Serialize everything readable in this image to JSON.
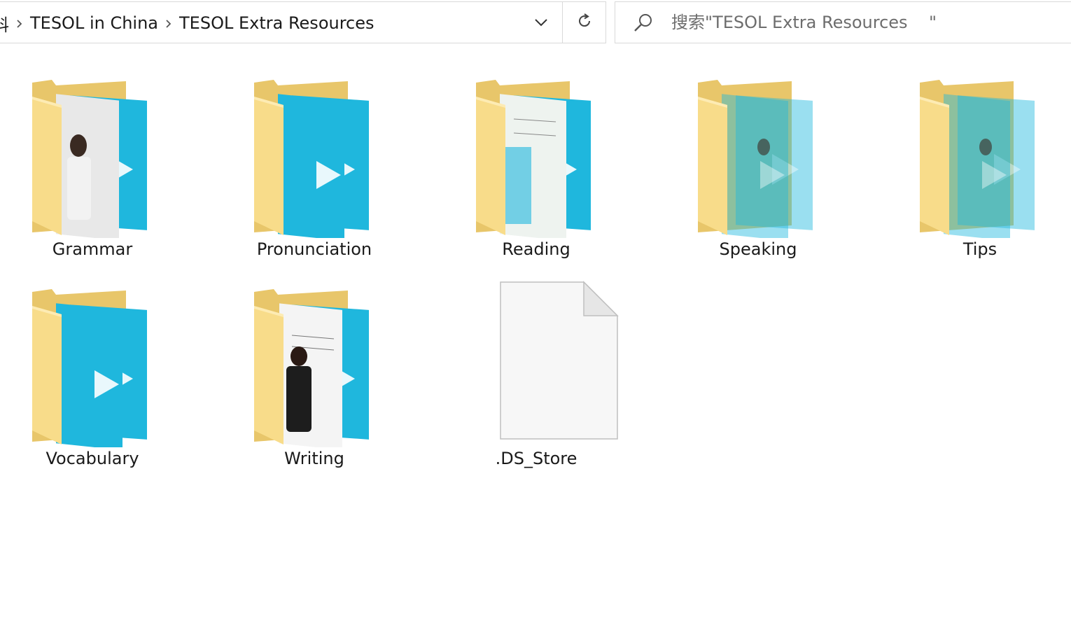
{
  "address_bar": {
    "crumb_partial": "资料",
    "crumbs": [
      "TESOL in China",
      "TESOL Extra Resources"
    ],
    "dropdown_icon": "chevron-down-icon",
    "refresh_icon": "refresh-icon"
  },
  "search": {
    "placeholder": "搜索\"TESOL Extra Resources    \"",
    "icon": "search-icon"
  },
  "items": [
    {
      "name": "Grammar",
      "type": "folder",
      "thumb": "person"
    },
    {
      "name": "Pronunciation",
      "type": "folder",
      "thumb": "logo"
    },
    {
      "name": "Reading",
      "type": "folder",
      "thumb": "whiteboard"
    },
    {
      "name": "Speaking",
      "type": "folder",
      "thumb": "faded"
    },
    {
      "name": "Tips",
      "type": "folder",
      "thumb": "faded"
    },
    {
      "name": "Vocabulary",
      "type": "folder",
      "thumb": "logo"
    },
    {
      "name": "Writing",
      "type": "folder",
      "thumb": "woman"
    },
    {
      "name": ".DS_Store",
      "type": "file"
    }
  ],
  "colors": {
    "folder_back": "#e8c66a",
    "folder_front": "#f8dc8a",
    "thumb_blue": "#1fb7dd",
    "border": "#d9d9d9"
  }
}
